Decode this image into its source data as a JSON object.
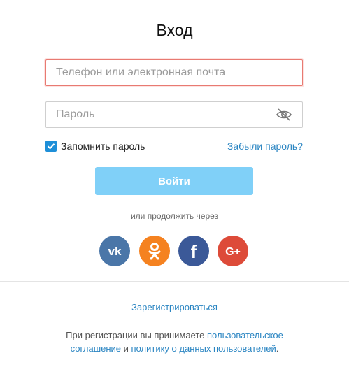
{
  "form": {
    "title": "Вход",
    "login_placeholder": "Телефон или электронная почта",
    "login_value": "",
    "password_placeholder": "Пароль",
    "password_value": "",
    "remember_label": "Запомнить пароль",
    "remember_checked": true,
    "forgot_label": "Забыли пароль?",
    "submit_label": "Войти"
  },
  "social": {
    "label": "или продолжить через",
    "providers": [
      {
        "name": "vk",
        "icon": "vk-icon",
        "color": "#4a76a8"
      },
      {
        "name": "ok",
        "icon": "odnoklassniki-icon",
        "color": "#f58220"
      },
      {
        "name": "facebook",
        "icon": "facebook-icon",
        "color": "#3b5998"
      },
      {
        "name": "google-plus",
        "icon": "google-plus-icon",
        "color": "#dd4b39"
      }
    ]
  },
  "footer": {
    "register_label": "Зарегистрироваться",
    "terms_prefix": "При регистрации вы принимаете ",
    "terms_link_agreement": "пользовательское соглашение",
    "terms_and": " и ",
    "terms_link_policy": "политику о данных пользователей",
    "terms_suffix": "."
  },
  "colors": {
    "accent": "#2a85c2",
    "button": "#80d0f8",
    "input_focus_border": "#e87a72",
    "checkbox": "#1e8fd8"
  }
}
